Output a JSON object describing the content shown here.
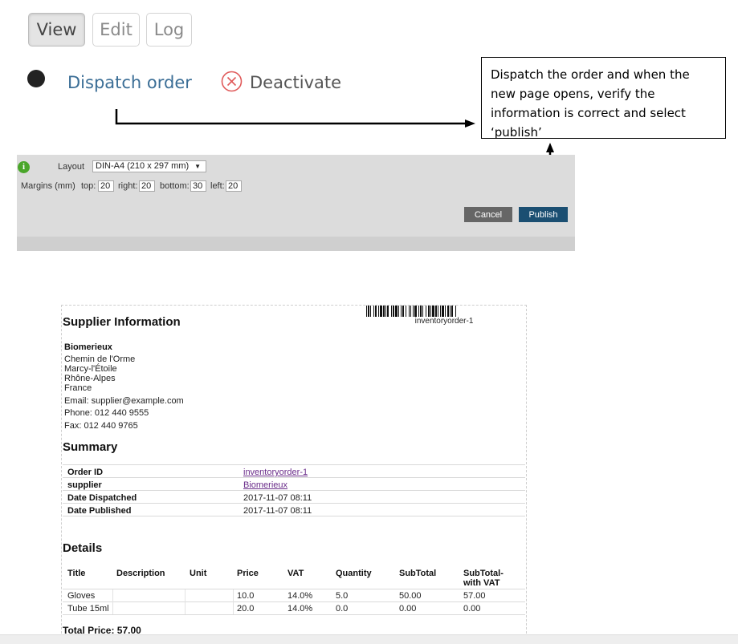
{
  "tabs": [
    {
      "label": "View",
      "active": true
    },
    {
      "label": "Edit",
      "active": false
    },
    {
      "label": "Log",
      "active": false
    }
  ],
  "actions": {
    "dispatch_label": "Dispatch order",
    "deactivate_label": "Deactivate"
  },
  "callout": {
    "text": "Dispatch the order and when the new page opens, verify the information is correct and select ‘publish’"
  },
  "print_settings": {
    "layout_label": "Layout",
    "layout_value": "DIN-A4 (210 x 297 mm)",
    "margins_label": "Margins (mm)",
    "top_label": "top:",
    "top_value": "20",
    "right_label": "right:",
    "right_value": "20",
    "bottom_label": "bottom:",
    "bottom_value": "30",
    "left_label": "left:",
    "left_value": "20",
    "cancel_label": "Cancel",
    "publish_label": "Publish"
  },
  "document": {
    "barcode_caption": "inventoryorder-1",
    "supplier_heading": "Supplier Information",
    "supplier": {
      "name": "Biomerieux",
      "address": [
        "Chemin de l'Orme",
        "Marcy-l'Étoile",
        "Rhône-Alpes",
        "France"
      ],
      "email": "Email: supplier@example.com",
      "phone": "Phone: 012 440 9555",
      "fax": "Fax: 012 440 9765"
    },
    "summary_heading": "Summary",
    "summary": [
      {
        "label": "Order ID",
        "value": "inventoryorder-1",
        "link": true
      },
      {
        "label": "supplier",
        "value": "Biomerieux",
        "link": true
      },
      {
        "label": "Date Dispatched",
        "value": "2017-11-07 08:11",
        "link": false
      },
      {
        "label": "Date Published",
        "value": "2017-11-07 08:11",
        "link": false
      }
    ],
    "details_heading": "Details",
    "columns": [
      "Title",
      "Description",
      "Unit",
      "Price",
      "VAT",
      "Quantity",
      "SubTotal",
      "SubTotal-\nwith VAT"
    ],
    "rows": [
      [
        "Gloves",
        "",
        "",
        "10.0",
        "14.0%",
        "5.0",
        "50.00",
        "57.00"
      ],
      [
        "Tube 15ml",
        "",
        "",
        "20.0",
        "14.0%",
        "0.0",
        "0.00",
        "0.00"
      ]
    ],
    "total": "Total Price: 57.00"
  },
  "colors": {
    "publish_button": "#1b4f72",
    "cancel_button": "#666666",
    "link": "#3b6e96",
    "deactivate_icon": "#e05a5a"
  }
}
